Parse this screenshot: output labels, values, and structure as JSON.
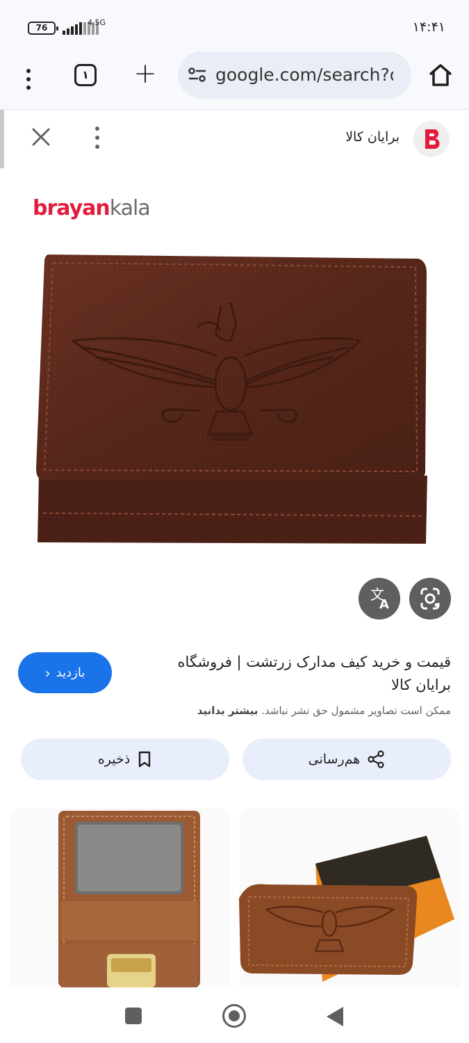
{
  "status_bar": {
    "battery": "76",
    "network": "4.5G",
    "time": "۱۴:۴۱"
  },
  "browser": {
    "tab_count": "۱",
    "url": "google.com/search?q"
  },
  "source": {
    "site_name": "برایان کالا"
  },
  "image": {
    "brand_part1": "brayan",
    "brand_part2": "kala"
  },
  "result": {
    "title": "قیمت و خرید کیف مدارک زرتشت | فروشگاه برایان کالا",
    "visit_label": "بازدید",
    "copyright_note": "ممکن است تصاویر مشمول حق نشر نباشد.",
    "learn_more": "بیشتر بدانید"
  },
  "actions": {
    "share_label": "هم‌رسانی",
    "save_label": "ذخیره"
  },
  "colors": {
    "accent": "#1a73e8",
    "brand_red": "#e21c3c",
    "wallet_brown": "#5a2a1c"
  }
}
